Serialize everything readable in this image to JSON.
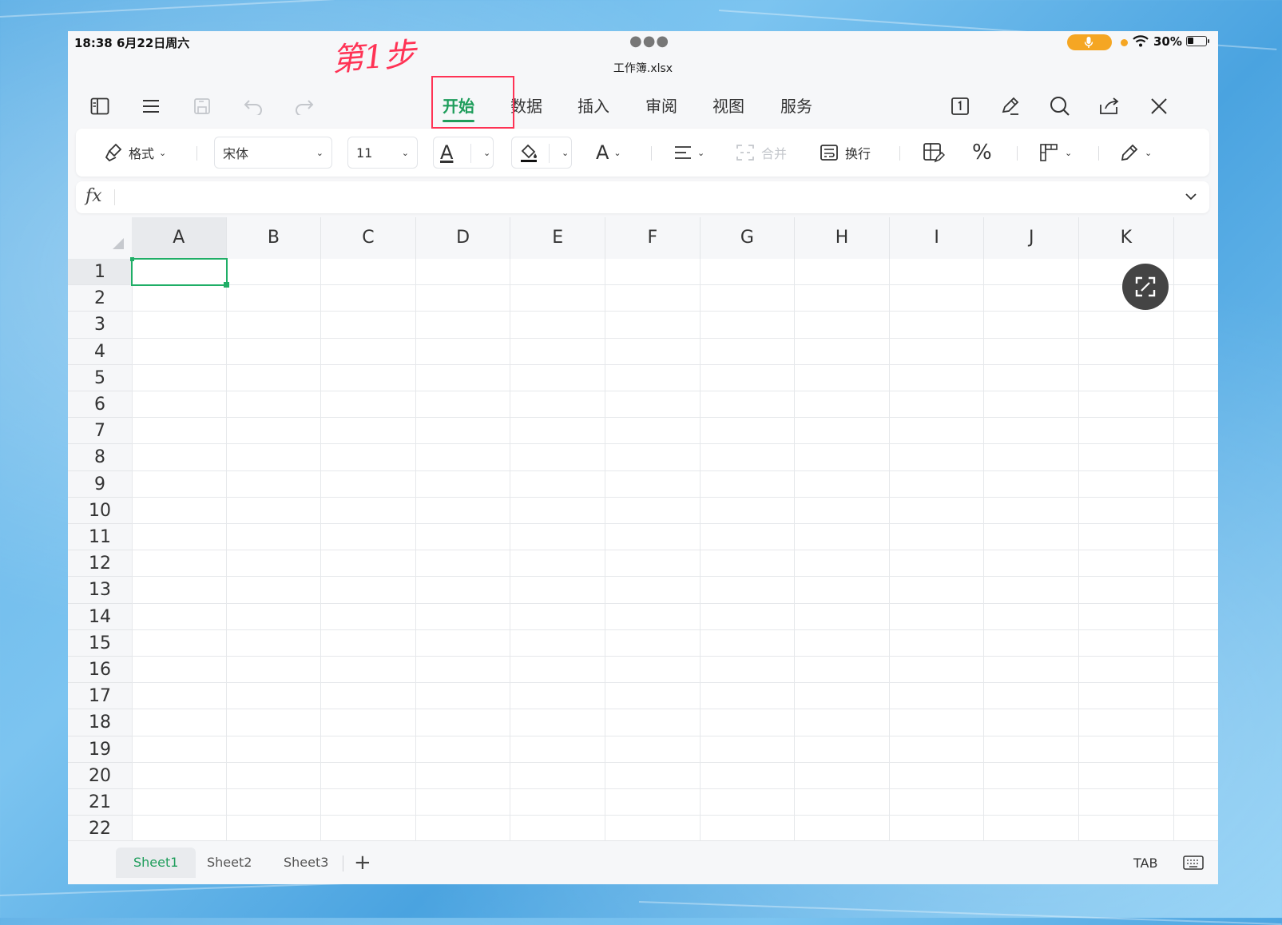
{
  "status_bar": {
    "time_date": "18:38   6月22日周六",
    "battery_percent": "30%"
  },
  "annotation": "第1步",
  "file": {
    "name": "工作簿.xlsx"
  },
  "menu_tabs": [
    {
      "label": "开始",
      "active": true
    },
    {
      "label": "数据"
    },
    {
      "label": "插入"
    },
    {
      "label": "审阅"
    },
    {
      "label": "视图"
    },
    {
      "label": "服务"
    }
  ],
  "ribbon": {
    "format_label": "格式",
    "font_name": "宋体",
    "font_size": "11",
    "font_color_glyph": "A",
    "font_style_glyph": "A",
    "merge_label": "合并",
    "wrap_label": "换行",
    "percent_glyph": "%"
  },
  "formula_bar": {
    "fx_label": "fx",
    "value": ""
  },
  "sheet": {
    "columns": [
      "A",
      "B",
      "C",
      "D",
      "E",
      "F",
      "G",
      "H",
      "I",
      "J",
      "K"
    ],
    "rows": [
      "1",
      "2",
      "3",
      "4",
      "5",
      "6",
      "7",
      "8",
      "9",
      "10",
      "11",
      "12",
      "13",
      "14",
      "15",
      "16",
      "17",
      "18",
      "19",
      "20",
      "21",
      "22"
    ],
    "selected_cell": "A1"
  },
  "sheet_tabs": [
    {
      "label": "Sheet1",
      "active": true
    },
    {
      "label": "Sheet2"
    },
    {
      "label": "Sheet3"
    }
  ],
  "bottom": {
    "tab_key_label": "TAB"
  },
  "colors": {
    "accent": "#1e9d5b",
    "annotation": "#ff3355",
    "selection": "#1fae66"
  }
}
